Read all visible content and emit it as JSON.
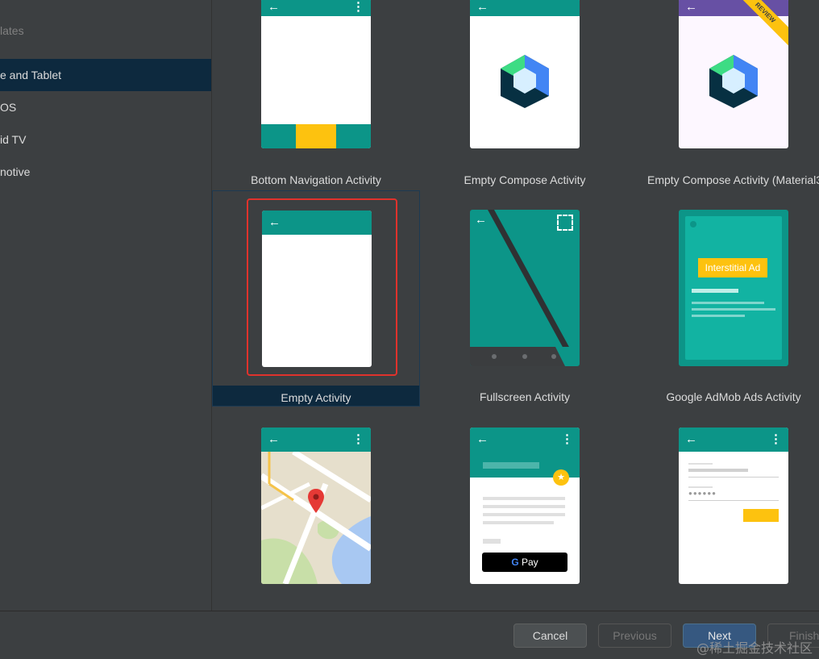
{
  "sidebar": {
    "title": "lates",
    "items": [
      {
        "label": "e and Tablet",
        "selected": true
      },
      {
        "label": "OS",
        "selected": false
      },
      {
        "label": "id TV",
        "selected": false
      },
      {
        "label": "notive",
        "selected": false
      }
    ]
  },
  "templates": [
    {
      "label": "Bottom Navigation Activity"
    },
    {
      "label": "Empty Compose Activity"
    },
    {
      "label": "Empty Compose Activity (Material3"
    },
    {
      "label": "Empty Activity",
      "selected": true
    },
    {
      "label": "Fullscreen Activity"
    },
    {
      "label": "Google AdMob Ads Activity",
      "ad_label": "Interstitial Ad"
    },
    {
      "label": ""
    },
    {
      "label": "",
      "pay_label": "Pay"
    },
    {
      "label": ""
    }
  ],
  "preview_badge": "REVIEW",
  "footer": {
    "cancel": "Cancel",
    "previous": "Previous",
    "next": "Next",
    "finish": "Finish"
  },
  "watermark": "@稀土掘金技术社区",
  "colors": {
    "teal": "#0c9588",
    "amber": "#fdc20f",
    "selection": "#0d293e",
    "highlight": "#e0322c"
  }
}
